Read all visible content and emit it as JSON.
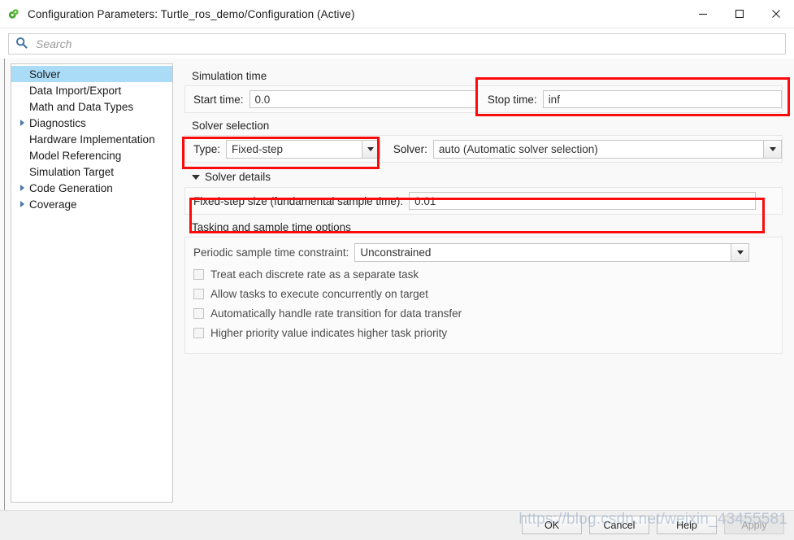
{
  "window": {
    "title": "Configuration Parameters: Turtle_ros_demo/Configuration (Active)",
    "app_icon": "simulink-icon",
    "minimize_label": "—",
    "maximize_label": "□",
    "close_label": "✕"
  },
  "search": {
    "placeholder": "Search",
    "value": "",
    "icon": "search-icon"
  },
  "sidebar": {
    "items": [
      {
        "label": "Solver",
        "expandable": false,
        "selected": true
      },
      {
        "label": "Data Import/Export",
        "expandable": false,
        "selected": false
      },
      {
        "label": "Math and Data Types",
        "expandable": false,
        "selected": false
      },
      {
        "label": "Diagnostics",
        "expandable": true,
        "selected": false
      },
      {
        "label": "Hardware Implementation",
        "expandable": false,
        "selected": false
      },
      {
        "label": "Model Referencing",
        "expandable": false,
        "selected": false
      },
      {
        "label": "Simulation Target",
        "expandable": false,
        "selected": false
      },
      {
        "label": "Code Generation",
        "expandable": true,
        "selected": false
      },
      {
        "label": "Coverage",
        "expandable": true,
        "selected": false
      }
    ]
  },
  "main": {
    "simulation_time": {
      "title": "Simulation time",
      "start_time_label": "Start time:",
      "start_time_value": "0.0",
      "stop_time_label": "Stop time:",
      "stop_time_value": "inf"
    },
    "solver_selection": {
      "title": "Solver selection",
      "type_label": "Type:",
      "type_value": "Fixed-step",
      "solver_label": "Solver:",
      "solver_value": "auto (Automatic solver selection)"
    },
    "solver_details": {
      "title": "Solver details",
      "fixed_step_label": "Fixed-step size (fundamental sample time):",
      "fixed_step_value": "0.01"
    },
    "tasking": {
      "title": "Tasking and sample time options",
      "periodic_label": "Periodic sample time constraint:",
      "periodic_value": "Unconstrained",
      "checkboxes": [
        {
          "label": "Treat each discrete rate as a separate task",
          "checked": false
        },
        {
          "label": "Allow tasks to execute concurrently on target",
          "checked": false
        },
        {
          "label": "Automatically handle rate transition for data transfer",
          "checked": false
        },
        {
          "label": "Higher priority value indicates higher task priority",
          "checked": false
        }
      ]
    }
  },
  "footer": {
    "ok_label": "OK",
    "cancel_label": "Cancel",
    "help_label": "Help",
    "apply_label": "Apply",
    "apply_enabled": false
  },
  "watermark": {
    "text": "https://blog.csdn.net/weixin_43455581"
  },
  "colors": {
    "annotation": "#fb0b0b",
    "selection": "#aadcf7",
    "search_icon": "#3b6ea5"
  }
}
